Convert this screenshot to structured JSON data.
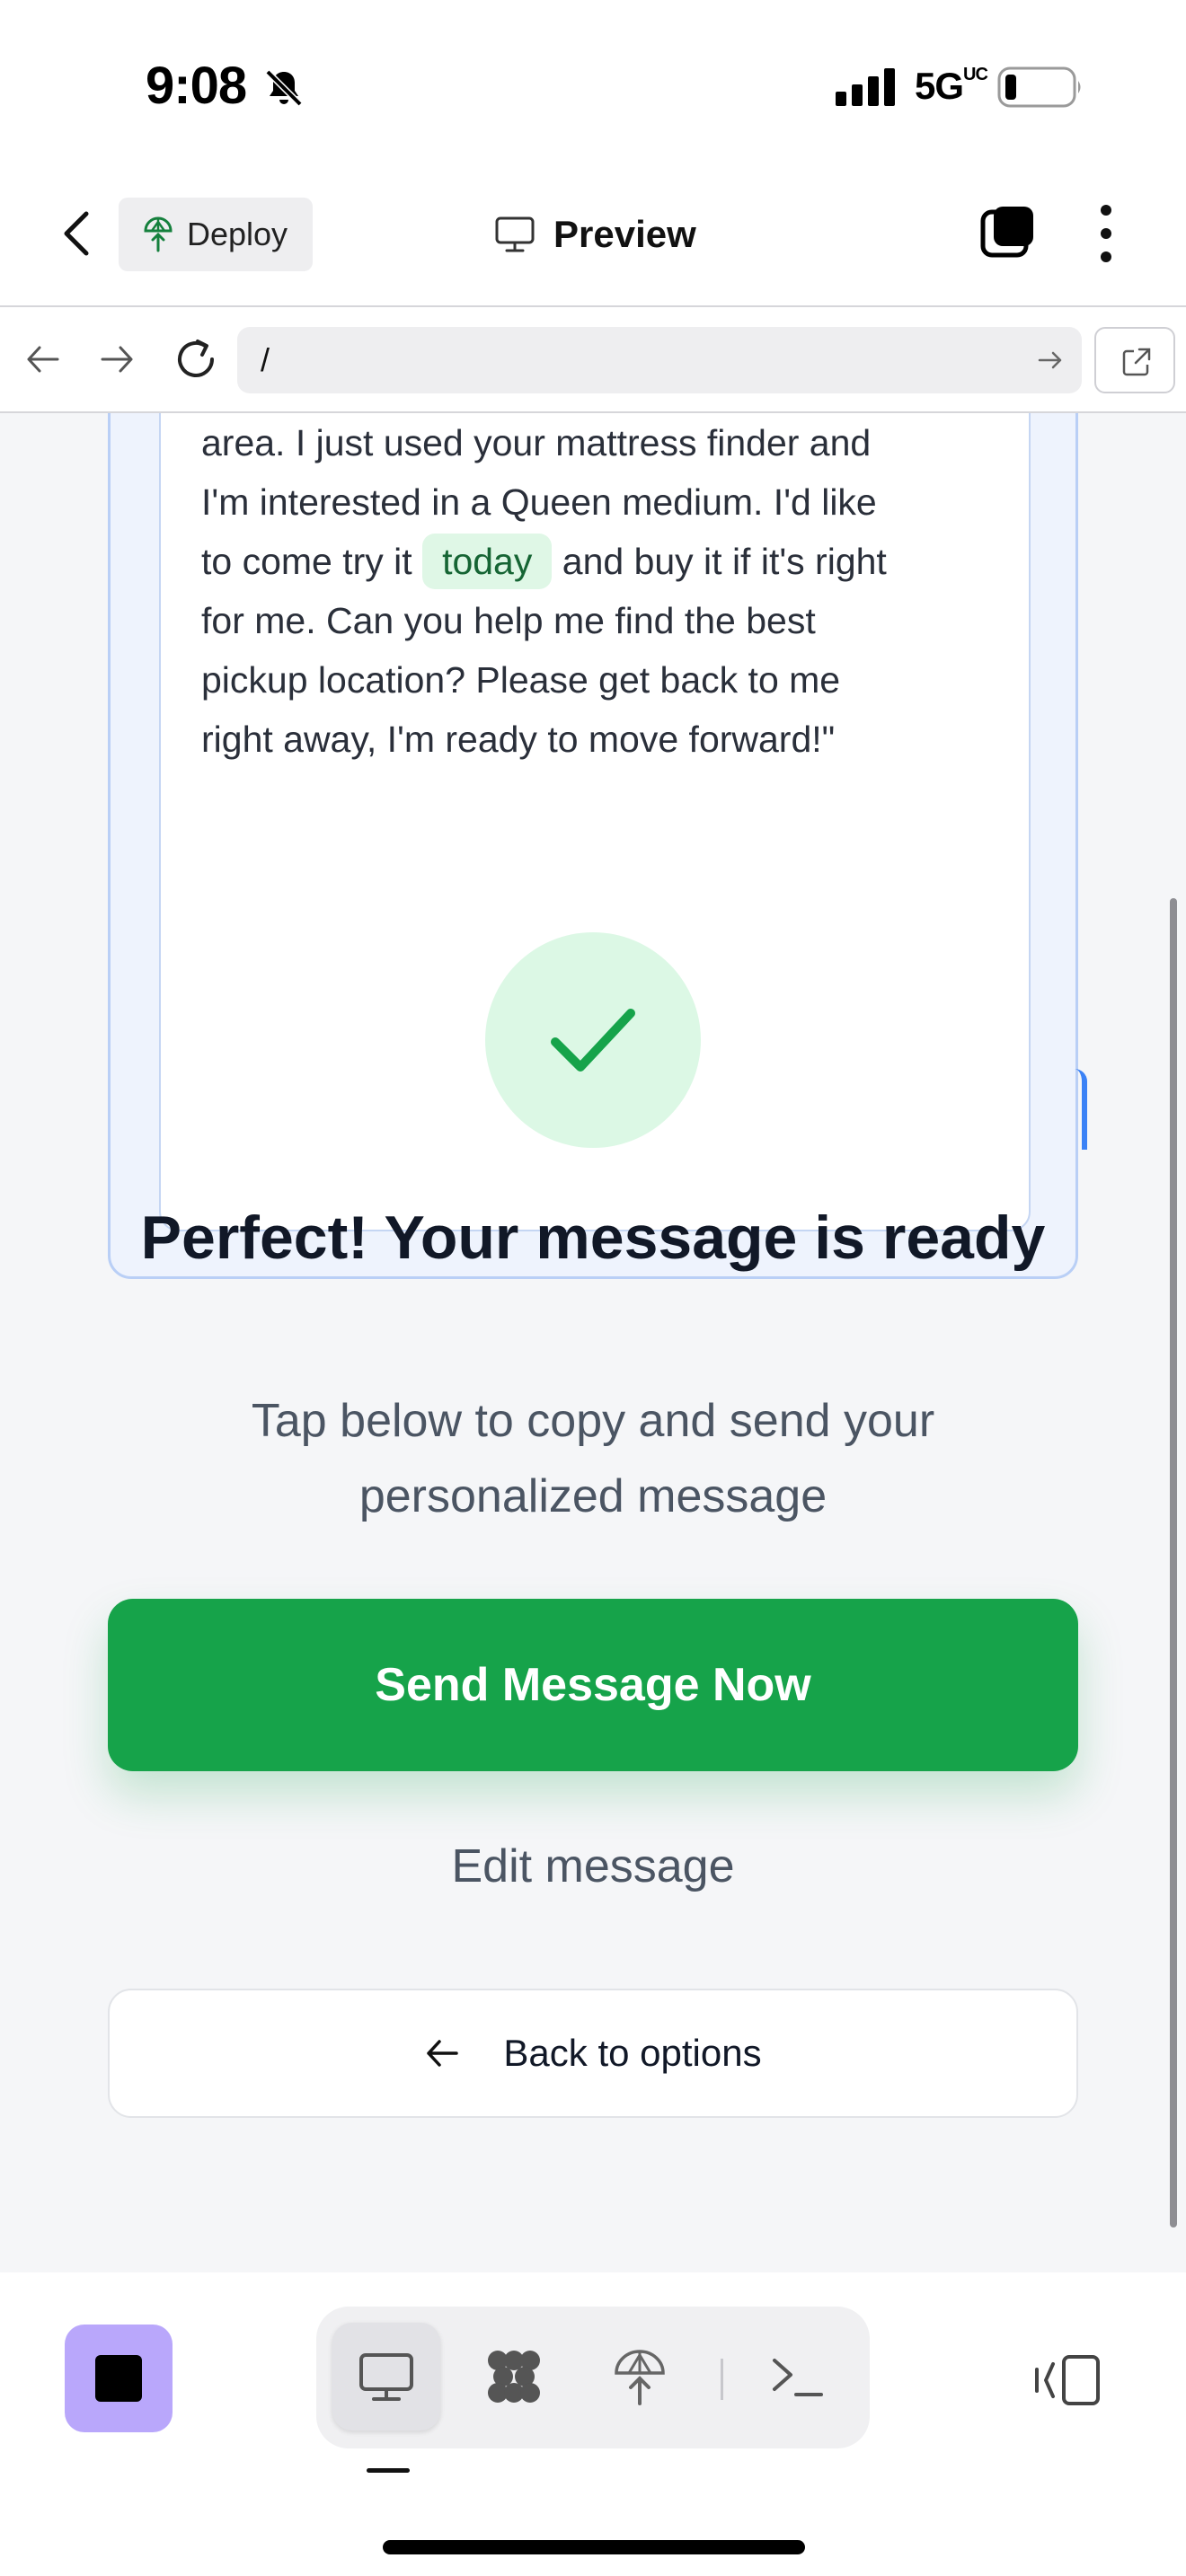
{
  "status_bar": {
    "time": "9:08",
    "network": "5G",
    "network_sup": "UC",
    "icons": [
      "bell-slash-icon",
      "signal-icon",
      "battery-icon"
    ]
  },
  "header": {
    "deploy_label": "Deploy",
    "title": "Preview",
    "icons": [
      "back-chevron-icon",
      "deploy-tree-icon",
      "monitor-icon",
      "tabs-icon",
      "more-vertical-icon"
    ]
  },
  "browser": {
    "url": "/",
    "icons": [
      "arrow-left-icon",
      "arrow-right-icon",
      "reload-icon",
      "go-arrow-icon",
      "external-link-icon"
    ]
  },
  "message": {
    "line1": "area. I just used your mattress finder and",
    "line2": "I'm interested in a Queen medium. I'd like",
    "line3_before": "to come try it ",
    "line3_highlight": "today",
    "line3_after": " and buy it if it's right",
    "line4": "for me. Can you help me find the best",
    "line5": "pickup location? Please get back to me",
    "line6": "right away, I'm ready to move forward!\""
  },
  "success": {
    "icon": "checkmark-icon",
    "title": "Perfect! Your message is ready",
    "subtitle": "Tap below to copy and send your personalized message"
  },
  "actions": {
    "send_label": "Send Message Now",
    "edit_label": "Edit message",
    "back_label": "Back to options"
  },
  "dock": {
    "icons": [
      "stop-icon",
      "monitor-icon",
      "components-icon",
      "deploy-icon",
      "terminal-icon",
      "panel-toggle-icon"
    ]
  },
  "colors": {
    "accent_green": "#16a34a",
    "success_bg": "#dcf8e5",
    "highlight_bg": "#dff7e6",
    "card_border": "#b9cff6",
    "stop_purple": "#b9a7fb"
  }
}
